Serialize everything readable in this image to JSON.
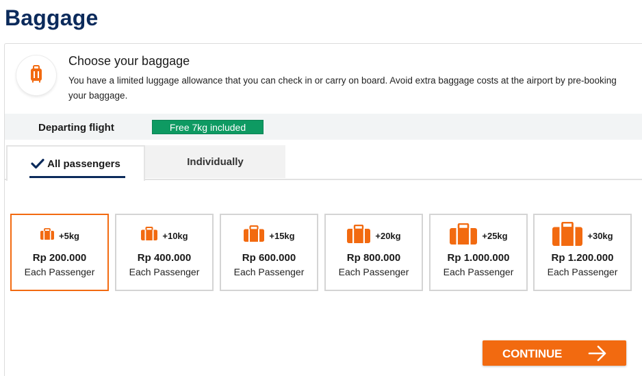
{
  "page": {
    "title": "Baggage"
  },
  "intro": {
    "heading": "Choose your baggage",
    "text": "You have a limited luggage allowance that you can check in or carry on board. Avoid extra baggage costs at the airport by pre-booking your baggage.",
    "icon": "luggage-icon"
  },
  "flight": {
    "label": "Departing flight",
    "badge": "Free 7kg included",
    "badge_color": "#0e9a62"
  },
  "tabs": [
    {
      "label": "All passengers",
      "selected": true,
      "icon": "check-icon"
    },
    {
      "label": "Individually",
      "selected": false
    }
  ],
  "options": [
    {
      "weight": "+5kg",
      "price": "Rp 200.000",
      "each": "Each Passenger",
      "selected": true
    },
    {
      "weight": "+10kg",
      "price": "Rp 400.000",
      "each": "Each Passenger",
      "selected": false
    },
    {
      "weight": "+15kg",
      "price": "Rp 600.000",
      "each": "Each Passenger",
      "selected": false
    },
    {
      "weight": "+20kg",
      "price": "Rp 800.000",
      "each": "Each Passenger",
      "selected": false
    },
    {
      "weight": "+25kg",
      "price": "Rp 1.000.000",
      "each": "Each Passenger",
      "selected": false
    },
    {
      "weight": "+30kg",
      "price": "Rp 1.200.000",
      "each": "Each Passenger",
      "selected": false
    }
  ],
  "continue": {
    "label": "CONTINUE",
    "icon": "arrow-right-icon"
  },
  "colors": {
    "accent": "#f26a10",
    "brand": "#0b2a5b",
    "success": "#0e9a62"
  }
}
